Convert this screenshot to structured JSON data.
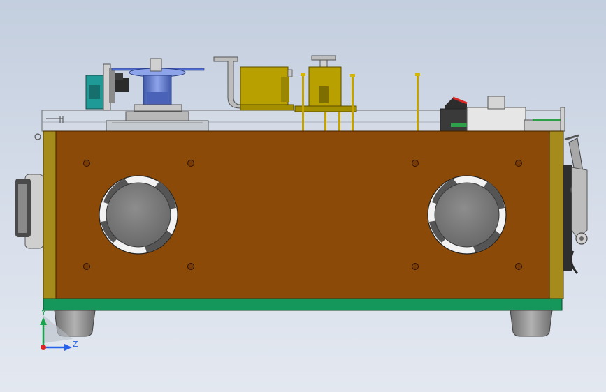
{
  "triad": {
    "y_label": "Y",
    "z_label": "Z",
    "y_color": "#16a34a",
    "z_color": "#2563eb",
    "origin_color": "#dc2626"
  },
  "colors": {
    "background_top": "#c3cede",
    "cabinet_wood": "#8b4a08",
    "cabinet_edge": "#a58a1c",
    "base_plate": "#15965a",
    "feet": "#8a8a8a",
    "fan_hub": "#777777",
    "brass_parts": "#b8a000",
    "blue_spindle": "#6c86d8",
    "teal_motor": "#1f9a96"
  },
  "icons": [
    "coordinate-triad-icon"
  ]
}
